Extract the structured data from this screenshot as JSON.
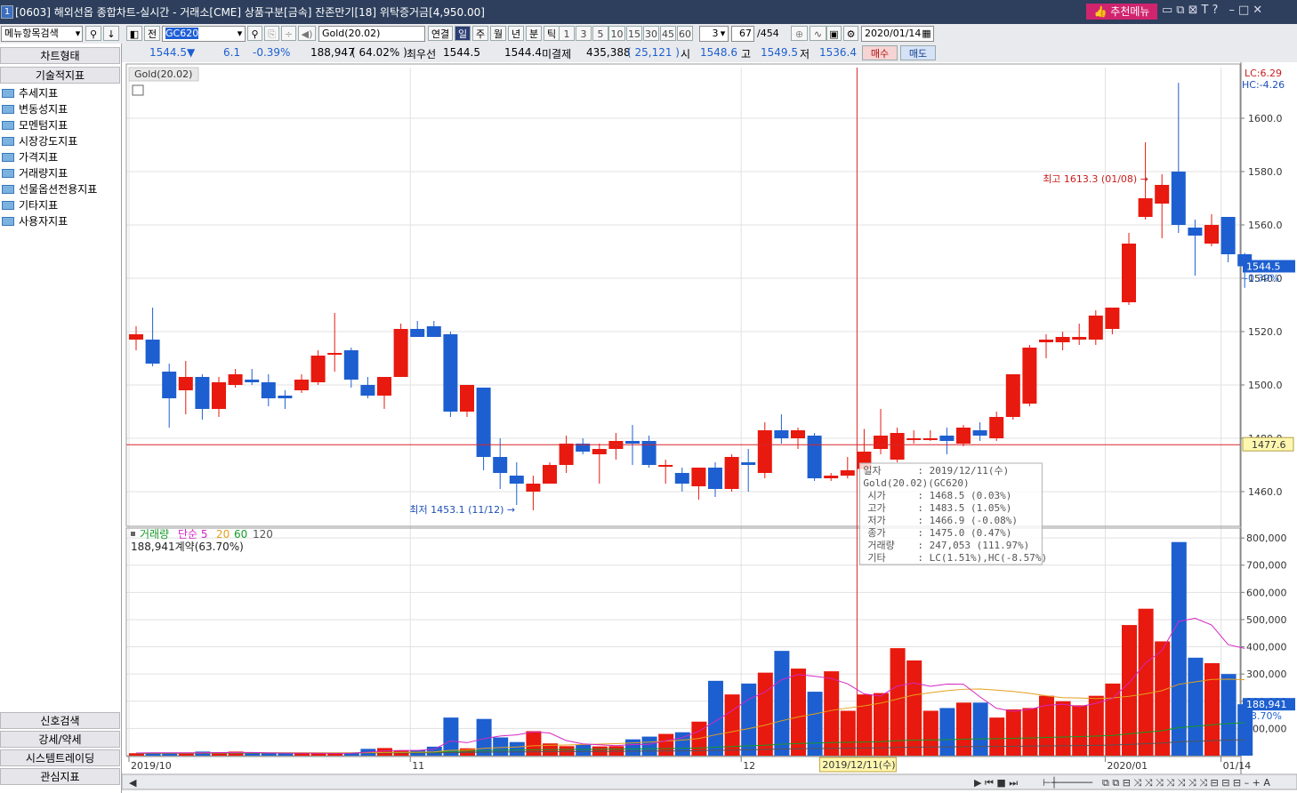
{
  "window": {
    "title": "[0603] 해외선옵 종합차트-실시간 - 거래소[CME] 상품구분[금속] 잔존만기[18] 위탁증거금[4,950.00]",
    "app_icon": "1",
    "recommend_menu": "추천메뉴",
    "window_icons": [
      "layout-icon",
      "restore-icon",
      "pin-icon",
      "font-icon",
      "help-icon",
      "minimize-icon",
      "maximize-icon",
      "close-icon"
    ]
  },
  "toolbar": {
    "menu_search": "메뉴항목검색",
    "prev_label": "전",
    "symbol_code": "GC620",
    "symbol_name": "Gold(20.02)",
    "link_label": "연결",
    "periods": [
      "일",
      "주",
      "월",
      "년",
      "분",
      "틱"
    ],
    "active_period": "일",
    "intervals": [
      "1",
      "3",
      "5",
      "10",
      "15",
      "30",
      "45",
      "60"
    ],
    "interval_value": "3",
    "count": "67",
    "total": "/454",
    "date": "2020/01/14"
  },
  "quote": {
    "price": "1544.5▼",
    "change": "6.1",
    "change_pct": "-0.39%",
    "volume": "188,947",
    "volume_pct": "( 64.02% )",
    "best_label": "최우선",
    "best_bid": "1544.5",
    "best_ask": "1544.4",
    "open_int_label": "미결제",
    "open_int": "435,388",
    "open_int_chg": "( 25,121 )",
    "open_label": "시",
    "open": "1548.6",
    "high_label": "고",
    "high": "1549.5",
    "low_label": "저",
    "low": "1536.4",
    "buy": "매수",
    "sell": "매도"
  },
  "sidebar": {
    "chart_type": "차트형태",
    "tech_header": "기술적지표",
    "items": [
      "추세지표",
      "변동성지표",
      "모멘텀지표",
      "시장강도지표",
      "가격지표",
      "거래량지표",
      "선물옵션전용지표",
      "기타지표",
      "사용자지표"
    ],
    "bottom": [
      "신호검색",
      "강세/약세",
      "시스템트레이딩",
      "관심지표"
    ]
  },
  "colors": {
    "up": "#e8190e",
    "down": "#1d5fd0",
    "ma5": "#d526c4",
    "ma20": "#e3a01c",
    "ma60": "#159b28",
    "ma120": "#555555",
    "crosshair": "#d8262b"
  },
  "chart_data": {
    "type": "candlestick",
    "title": "Gold(20.02)",
    "price_axis": {
      "ticks": [
        1460,
        1480,
        1500,
        1520,
        1540,
        1560,
        1580,
        1600
      ],
      "tick_labels": [
        "1460.0",
        "1480.0",
        "1500.0",
        "1520.0",
        "1540.0",
        "1560.0",
        "1580.0",
        "1600.0"
      ],
      "range": [
        1447,
        1619
      ]
    },
    "volume_axis": {
      "ticks": [
        100000,
        200000,
        300000,
        400000,
        500000,
        600000,
        700000,
        800000
      ],
      "tick_labels": [
        "100,000",
        "200,000",
        "300,000",
        "400,000",
        "500,000",
        "600,000",
        "700,000",
        "800,000"
      ],
      "range": [
        0,
        820000
      ]
    },
    "x_labels": [
      {
        "text": "2019/10",
        "index": 0
      },
      {
        "text": "11",
        "index": 17
      },
      {
        "text": "12",
        "index": 37
      },
      {
        "text": "2020/01",
        "index": 59
      },
      {
        "text": "01/14",
        "index": 66
      }
    ],
    "candles": [
      {
        "o": 1517,
        "h": 1522,
        "l": 1513,
        "c": 1519
      },
      {
        "o": 1517,
        "h": 1529,
        "l": 1507,
        "c": 1508
      },
      {
        "o": 1505,
        "h": 1508,
        "l": 1484,
        "c": 1495
      },
      {
        "o": 1498,
        "h": 1509,
        "l": 1489,
        "c": 1503
      },
      {
        "o": 1503,
        "h": 1504,
        "l": 1487,
        "c": 1491
      },
      {
        "o": 1491,
        "h": 1503,
        "l": 1488,
        "c": 1501
      },
      {
        "o": 1500,
        "h": 1506,
        "l": 1499,
        "c": 1504
      },
      {
        "o": 1502,
        "h": 1506,
        "l": 1500,
        "c": 1501
      },
      {
        "o": 1501,
        "h": 1504,
        "l": 1492,
        "c": 1495
      },
      {
        "o": 1496,
        "h": 1498,
        "l": 1491,
        "c": 1495
      },
      {
        "o": 1498,
        "h": 1504,
        "l": 1497,
        "c": 1502
      },
      {
        "o": 1501,
        "h": 1513,
        "l": 1500,
        "c": 1511
      },
      {
        "o": 1512,
        "h": 1527,
        "l": 1505,
        "c": 1512
      },
      {
        "o": 1513,
        "h": 1514,
        "l": 1499,
        "c": 1502
      },
      {
        "o": 1500,
        "h": 1503,
        "l": 1495,
        "c": 1496
      },
      {
        "o": 1496,
        "h": 1503,
        "l": 1491,
        "c": 1503
      },
      {
        "o": 1503,
        "h": 1523,
        "l": 1503,
        "c": 1521
      },
      {
        "o": 1521,
        "h": 1524,
        "l": 1518,
        "c": 1518
      },
      {
        "o": 1522,
        "h": 1524,
        "l": 1519,
        "c": 1518
      },
      {
        "o": 1519,
        "h": 1520,
        "l": 1488,
        "c": 1490
      },
      {
        "o": 1490,
        "h": 1500,
        "l": 1488,
        "c": 1500
      },
      {
        "o": 1499,
        "h": 1499,
        "l": 1468,
        "c": 1473
      },
      {
        "o": 1473,
        "h": 1480,
        "l": 1461,
        "c": 1467
      },
      {
        "o": 1466,
        "h": 1471,
        "l": 1455,
        "c": 1463
      },
      {
        "o": 1460,
        "h": 1466,
        "l": 1453,
        "c": 1463
      },
      {
        "o": 1463,
        "h": 1471,
        "l": 1463,
        "c": 1470
      },
      {
        "o": 1470,
        "h": 1481,
        "l": 1467,
        "c": 1478
      },
      {
        "o": 1478,
        "h": 1480,
        "l": 1474,
        "c": 1475
      },
      {
        "o": 1474,
        "h": 1478,
        "l": 1463,
        "c": 1476
      },
      {
        "o": 1476,
        "h": 1482,
        "l": 1472,
        "c": 1479
      },
      {
        "o": 1479,
        "h": 1485,
        "l": 1470,
        "c": 1478
      },
      {
        "o": 1479,
        "h": 1481,
        "l": 1469,
        "c": 1470
      },
      {
        "o": 1470,
        "h": 1472,
        "l": 1463,
        "c": 1470
      },
      {
        "o": 1467,
        "h": 1469,
        "l": 1460,
        "c": 1463
      },
      {
        "o": 1462,
        "h": 1468,
        "l": 1457,
        "c": 1469
      },
      {
        "o": 1469,
        "h": 1471,
        "l": 1458,
        "c": 1461
      },
      {
        "o": 1461,
        "h": 1474,
        "l": 1460,
        "c": 1473
      },
      {
        "o": 1471,
        "h": 1476,
        "l": 1460,
        "c": 1470
      },
      {
        "o": 1467,
        "h": 1486,
        "l": 1465,
        "c": 1483
      },
      {
        "o": 1483,
        "h": 1489,
        "l": 1478,
        "c": 1480
      },
      {
        "o": 1480,
        "h": 1484,
        "l": 1476,
        "c": 1483
      },
      {
        "o": 1481,
        "h": 1482,
        "l": 1464,
        "c": 1465
      },
      {
        "o": 1465,
        "h": 1467,
        "l": 1464,
        "c": 1466
      },
      {
        "o": 1466,
        "h": 1473,
        "l": 1465,
        "c": 1468
      },
      {
        "o": 1468.5,
        "h": 1483.5,
        "l": 1466.9,
        "c": 1475
      },
      {
        "o": 1476,
        "h": 1491,
        "l": 1474,
        "c": 1481
      },
      {
        "o": 1472,
        "h": 1484,
        "l": 1471,
        "c": 1482
      },
      {
        "o": 1480,
        "h": 1483,
        "l": 1478,
        "c": 1480
      },
      {
        "o": 1480,
        "h": 1483,
        "l": 1479,
        "c": 1480
      },
      {
        "o": 1481,
        "h": 1484,
        "l": 1474,
        "c": 1479
      },
      {
        "o": 1478,
        "h": 1485,
        "l": 1477,
        "c": 1484
      },
      {
        "o": 1483,
        "h": 1486,
        "l": 1479,
        "c": 1481
      },
      {
        "o": 1480,
        "h": 1490,
        "l": 1479,
        "c": 1488
      },
      {
        "o": 1488,
        "h": 1504,
        "l": 1487,
        "c": 1504
      },
      {
        "o": 1493,
        "h": 1515,
        "l": 1492,
        "c": 1514
      },
      {
        "o": 1516,
        "h": 1519,
        "l": 1510,
        "c": 1517
      },
      {
        "o": 1516,
        "h": 1520,
        "l": 1513,
        "c": 1518
      },
      {
        "o": 1517,
        "h": 1523,
        "l": 1515,
        "c": 1518
      },
      {
        "o": 1517,
        "h": 1528,
        "l": 1515,
        "c": 1526
      },
      {
        "o": 1521,
        "h": 1529,
        "l": 1519,
        "c": 1529
      },
      {
        "o": 1531,
        "h": 1557,
        "l": 1530,
        "c": 1553
      },
      {
        "o": 1563,
        "h": 1591,
        "l": 1562,
        "c": 1570
      },
      {
        "o": 1568,
        "h": 1579,
        "l": 1555,
        "c": 1575
      },
      {
        "o": 1580,
        "h": 1613.3,
        "l": 1557,
        "c": 1560
      },
      {
        "o": 1559,
        "h": 1562,
        "l": 1541,
        "c": 1556
      },
      {
        "o": 1553,
        "h": 1564,
        "l": 1552,
        "c": 1560
      },
      {
        "o": 1563,
        "h": 1563,
        "l": 1546,
        "c": 1549
      },
      {
        "o": 1549,
        "h": 1549.5,
        "l": 1536.4,
        "c": 1544.5
      }
    ],
    "volume": [
      9000,
      11000,
      9000,
      10000,
      15000,
      12000,
      15000,
      12000,
      9000,
      8000,
      9000,
      8000,
      8000,
      10000,
      25000,
      28000,
      18000,
      20000,
      33000,
      140000,
      27000,
      135000,
      67000,
      50000,
      90000,
      45000,
      35000,
      40000,
      34000,
      35000,
      60000,
      70000,
      80000,
      86000,
      125000,
      275000,
      225000,
      265000,
      305000,
      385000,
      320000,
      235000,
      310000,
      165000,
      225000,
      230000,
      395000,
      350000,
      165000,
      175000,
      195000,
      195000,
      140000,
      170000,
      175000,
      220000,
      200000,
      185000,
      220000,
      265000,
      480000,
      540000,
      420000,
      785000,
      360000,
      340000,
      300000,
      188941
    ],
    "ma5": [
      10000,
      10800,
      10600,
      10600,
      10800,
      11400,
      11800,
      11800,
      10400,
      9400,
      8800,
      8800,
      8200,
      8800,
      13000,
      17600,
      19000,
      19200,
      23600,
      54200,
      47600,
      62000,
      72200,
      76200,
      87400,
      83200,
      55400,
      43400,
      40200,
      36800,
      40800,
      41800,
      54800,
      66000,
      89400,
      126400,
      164400,
      207000,
      233000,
      279000,
      298000,
      292000,
      284000,
      264000,
      227000,
      219000,
      256000,
      267000,
      255000,
      263000,
      262600,
      216000,
      174000,
      163000,
      170000,
      185000,
      189000,
      180000,
      192000,
      210000,
      267000,
      340000,
      386000,
      493000,
      505000,
      480000,
      408000,
      394000
    ],
    "ma20": [
      9500,
      9800,
      9800,
      9700,
      10100,
      10300,
      10700,
      10900,
      10700,
      10600,
      10500,
      10300,
      10200,
      10300,
      11000,
      12000,
      12300,
      12700,
      13800,
      19600,
      20700,
      27000,
      29800,
      32000,
      36200,
      37800,
      39100,
      40700,
      42600,
      44200,
      46800,
      49900,
      53500,
      57300,
      62900,
      76600,
      87800,
      99300,
      112000,
      128000,
      142000,
      153000,
      166000,
      175000,
      183000,
      193000,
      208000,
      223000,
      231000,
      239000,
      244000,
      245000,
      241000,
      236000,
      229000,
      220000,
      213000,
      212000,
      210000,
      212000,
      218000,
      227000,
      239000,
      262000,
      271000,
      280000,
      281000,
      279000
    ],
    "ma60": [
      9000,
      9300,
      9400,
      9500,
      9700,
      9900,
      10100,
      10300,
      10400,
      10400,
      10400,
      10400,
      10400,
      10400,
      10800,
      11400,
      11700,
      12000,
      12600,
      15400,
      16300,
      18700,
      19900,
      20800,
      22000,
      22600,
      23000,
      23400,
      23800,
      24200,
      24800,
      25500,
      26200,
      27000,
      28300,
      31200,
      33500,
      35800,
      38500,
      42100,
      44700,
      46300,
      48200,
      49000,
      50000,
      51500,
      55000,
      57200,
      58000,
      59000,
      60300,
      61500,
      62500,
      63800,
      65000,
      66800,
      68500,
      70200,
      72000,
      74500,
      80000,
      86000,
      91500,
      103000,
      108000,
      113000,
      118000,
      121000
    ],
    "ma120": [
      8500,
      8600,
      8700,
      8800,
      8900,
      9000,
      9100,
      9200,
      9300,
      9400,
      9500,
      9600,
      9700,
      9800,
      10000,
      10200,
      10400,
      10600,
      10800,
      11600,
      12000,
      12900,
      13400,
      13800,
      14400,
      14700,
      15000,
      15300,
      15600,
      15900,
      16300,
      16700,
      17100,
      17600,
      18200,
      19500,
      20500,
      21500,
      22700,
      24300,
      25400,
      26100,
      27000,
      27500,
      28000,
      28700,
      30300,
      31300,
      31800,
      32300,
      32900,
      33400,
      33900,
      34500,
      35000,
      35800,
      36500,
      37200,
      38000,
      39000,
      41300,
      44000,
      46300,
      51000,
      53000,
      55000,
      57000,
      58500
    ],
    "crosshair_index": 44,
    "crosshair_price": 1477.6,
    "crosshair_price_label": "1477.6",
    "crosshair_date": "2019/12/11(수)",
    "current_price_label": "1544.5",
    "current_pct_label": "-0.39%",
    "lc_label": "LC:6.29",
    "hc_label": "HC:-4.26",
    "high_annotation": "최고 1613.3 (01/08)",
    "high_index": 62,
    "low_annotation": "최저 1453.1 (11/12)",
    "low_index": 24,
    "volume_legend": {
      "title": "거래량",
      "ma_type": "단순",
      "periods": [
        "5",
        "20",
        "60",
        "120"
      ]
    },
    "volume_text": "188,941계약(63.70%)",
    "volume_current_label": "188,941",
    "volume_current_pct": "63.70%",
    "tooltip": {
      "date_row": [
        "일자",
        "2019/12/11(수)"
      ],
      "symbol_row": "Gold(20.02)(GC620)",
      "rows": [
        [
          "시가",
          "1468.5 (0.03%)"
        ],
        [
          "고가",
          "1483.5 (1.05%)"
        ],
        [
          "저가",
          "1466.9 (-0.08%)"
        ],
        [
          "종가",
          "1475.0 (0.47%)"
        ],
        [
          "거래량",
          "247,053 (111.97%)"
        ],
        [
          "기타",
          "LC(1.51%),HC(-8.57%)"
        ]
      ]
    }
  }
}
